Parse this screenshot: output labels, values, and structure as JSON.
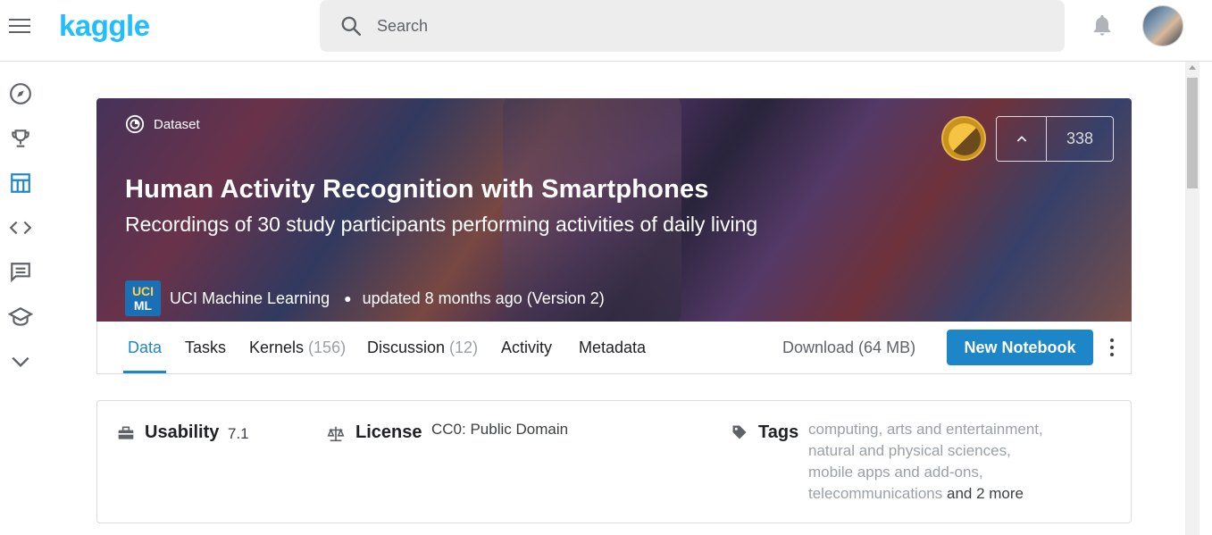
{
  "app": {
    "logo": "kaggle"
  },
  "search": {
    "placeholder": "Search"
  },
  "left_nav": {
    "items": [
      {
        "icon": "compass-icon",
        "label": "Datasets/Explore"
      },
      {
        "icon": "trophy-icon",
        "label": "Competitions"
      },
      {
        "icon": "table-icon",
        "label": "Datasets"
      },
      {
        "icon": "code-icon",
        "label": "Kernels"
      },
      {
        "icon": "discussion-icon",
        "label": "Discussion"
      },
      {
        "icon": "courses-icon",
        "label": "Courses"
      },
      {
        "icon": "chevron-down-icon",
        "label": "More"
      }
    ]
  },
  "dataset": {
    "type_label": "Dataset",
    "title": "Human Activity Recognition with Smartphones",
    "subtitle": "Recordings of 30 study participants performing activities of daily living",
    "owner_logo_line1": "UCI",
    "owner_logo_line2": "ML",
    "owner": "UCI Machine Learning",
    "updated": "updated 8 months ago (Version 2)",
    "upvotes": "338",
    "medal_color": "#f6c343"
  },
  "tabs": [
    {
      "label": "Data",
      "count": ""
    },
    {
      "label": "Tasks",
      "count": ""
    },
    {
      "label": "Kernels",
      "count": "(156)"
    },
    {
      "label": "Discussion",
      "count": "(12)"
    },
    {
      "label": "Activity",
      "count": ""
    },
    {
      "label": "Metadata",
      "count": ""
    }
  ],
  "actions": {
    "download_label": "Download (64 MB)",
    "new_notebook_label": "New Notebook"
  },
  "info": {
    "usability_label": "Usability",
    "usability_value": "7.1",
    "license_label": "License",
    "license_value": "CC0: Public Domain",
    "tags_label": "Tags",
    "tags": [
      "computing",
      "arts and entertainment",
      "natural and physical sciences",
      "mobile apps and add-ons",
      "telecommunications"
    ],
    "tags_more": "and 2 more"
  },
  "colors": {
    "accent": "#1d86c8",
    "brand": "#20beff"
  }
}
